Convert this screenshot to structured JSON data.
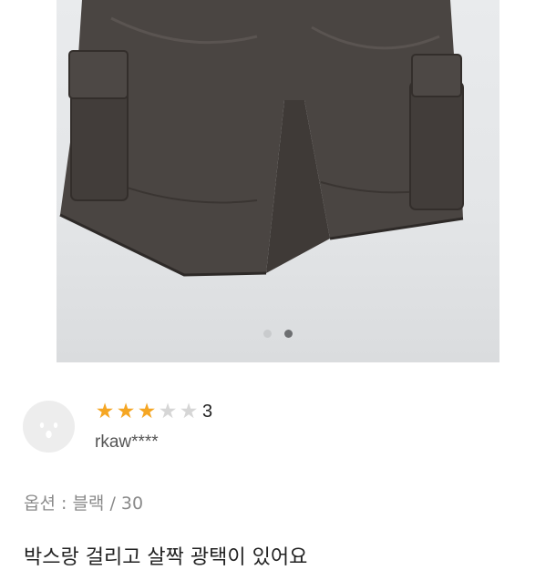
{
  "carousel": {
    "total": 2,
    "active_index": 1
  },
  "review": {
    "rating": 3,
    "max_rating": 5,
    "rating_text": "3",
    "username": "rkaw****",
    "option_text": "옵션 : 블랙 / 30",
    "body": "박스랑 걸리고 살짝 광택이 있어요"
  },
  "colors": {
    "star_filled": "#f5a623",
    "star_empty": "#d6d6d6"
  },
  "icons": {
    "avatar": "surprised-face-icon"
  }
}
